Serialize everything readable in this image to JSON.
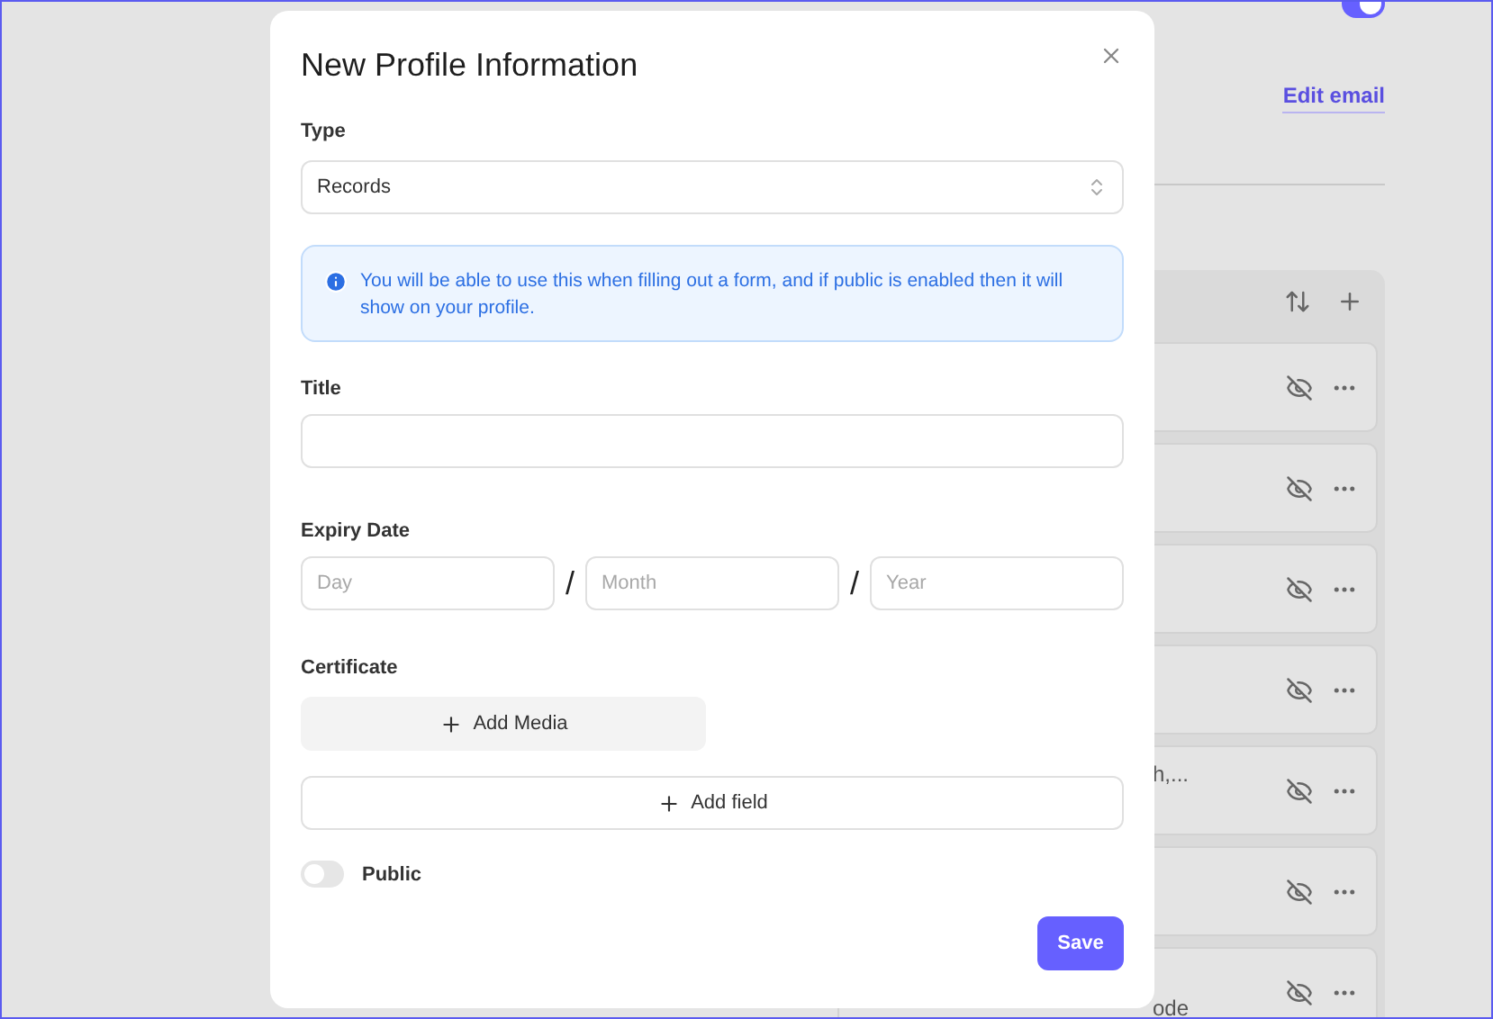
{
  "background": {
    "show_email": {
      "on": true
    },
    "edit_link": "Edit email",
    "cards": [
      {
        "hidden": true
      },
      {
        "hidden": true
      },
      {
        "hidden": true
      },
      {
        "hidden": true
      },
      {
        "hidden": true,
        "text": "h,..."
      },
      {
        "hidden": true
      },
      {
        "hidden": true,
        "text": "ode"
      }
    ]
  },
  "dialog": {
    "title": "New Profile Information",
    "type": {
      "label": "Type",
      "value": "Records"
    },
    "info": "You will be able to use this when filling out a form, and if public is enabled then it will show on your profile.",
    "title_field": {
      "label": "Title"
    },
    "expiry": {
      "label": "Expiry Date",
      "separator": "/",
      "fields": [
        {
          "placeholder": "Day"
        },
        {
          "placeholder": "Month"
        },
        {
          "placeholder": "Year"
        }
      ]
    },
    "certificate": {
      "label": "Certificate",
      "button": "Add Media"
    },
    "add_field": "Add field",
    "public": {
      "label": "Public",
      "on": false
    },
    "save": "Save"
  }
}
